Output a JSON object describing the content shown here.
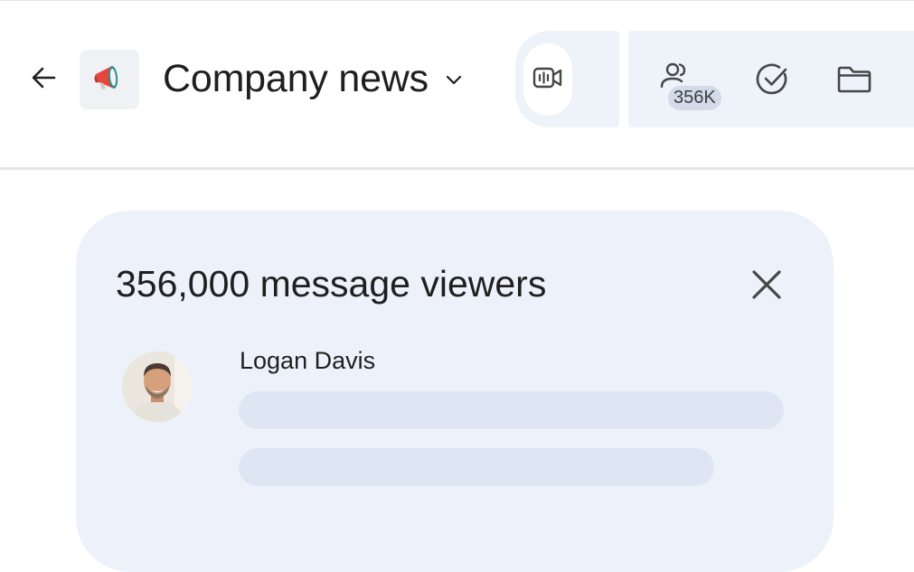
{
  "header": {
    "space_name": "Company news",
    "member_count_badge": "356K",
    "icons": {
      "back": "arrow-left-icon",
      "space": "megaphone-icon",
      "dropdown": "chevron-down-icon",
      "meet": "video-call-icon",
      "members": "people-icon",
      "tasks": "check-circle-icon",
      "files": "folder-icon"
    }
  },
  "viewers_panel": {
    "title": "356,000 message viewers",
    "close_icon": "close-icon",
    "viewers": [
      {
        "name": "Logan Davis"
      }
    ]
  },
  "colors": {
    "megaphone_red": "#e8453c",
    "megaphone_teal": "#2f8c8c",
    "panel_bg": "#edf2fa",
    "skeleton": "#dfe6f3"
  }
}
